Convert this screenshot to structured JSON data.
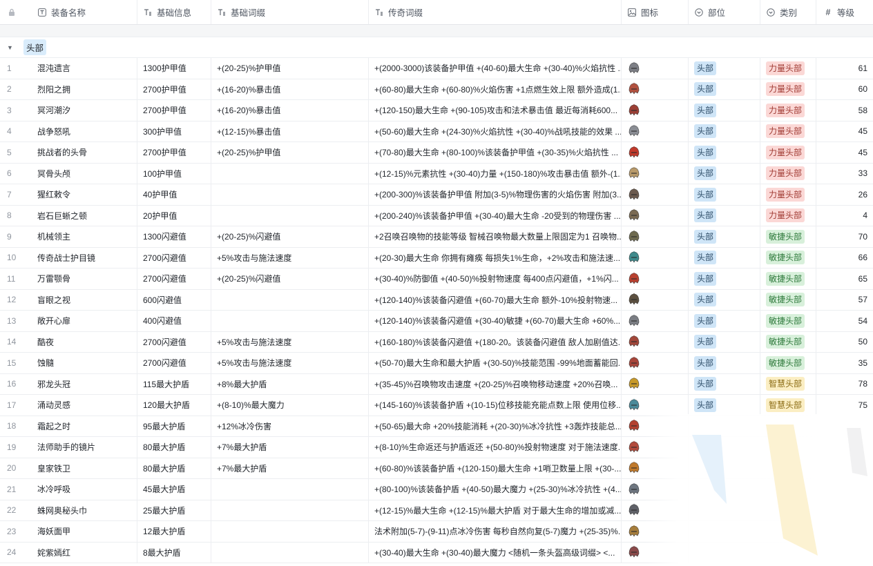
{
  "columns": [
    {
      "key": "lock",
      "label": "",
      "icon": "lock-icon"
    },
    {
      "key": "name",
      "label": "装备名称",
      "icon": "text-field-icon"
    },
    {
      "key": "base",
      "label": "基础信息",
      "icon": "long-text-icon"
    },
    {
      "key": "affix",
      "label": "基础词缀",
      "icon": "long-text-icon"
    },
    {
      "key": "legend",
      "label": "传奇词缀",
      "icon": "long-text-icon"
    },
    {
      "key": "img",
      "label": "图标",
      "icon": "image-icon"
    },
    {
      "key": "slot",
      "label": "部位",
      "icon": "single-select-icon"
    },
    {
      "key": "cat",
      "label": "类别",
      "icon": "single-select-icon"
    },
    {
      "key": "level",
      "label": "等级",
      "icon": "number-icon"
    }
  ],
  "group": {
    "label": "头部"
  },
  "colors": {
    "head": "#cfe5f7",
    "strength": "#fbd8d6",
    "agility": "#d8f0db",
    "intellect": "#fbeec3"
  },
  "rows": [
    {
      "n": "1",
      "name": "混沌遗言",
      "base": "1300护甲值",
      "affix": "+(20-25)%护甲值",
      "legend": "+(2000-3000)该装备护甲值 +(40-60)最大生命 +(30-40)%火焰抗性 ...",
      "slot": "头部",
      "cat": "力量头部",
      "catType": "str",
      "lvl": "61",
      "helm": "#7d7f86"
    },
    {
      "n": "2",
      "name": "烈阳之拥",
      "base": "2700护甲值",
      "affix": "+(16-20)%暴击值",
      "legend": "+(60-80)最大生命 +(60-80)%火焰伤害 +1点燃生效上限 额外造成(1...",
      "slot": "头部",
      "cat": "力量头部",
      "catType": "str",
      "lvl": "60",
      "helm": "#b2513f"
    },
    {
      "n": "3",
      "name": "冥河潮汐",
      "base": "2700护甲值",
      "affix": "+(16-20)%暴击值",
      "legend": "+(120-150)最大生命 +(90-105)攻击和法术暴击值 最近每消耗600...",
      "slot": "头部",
      "cat": "力量头部",
      "catType": "str",
      "lvl": "58",
      "helm": "#9c3f35"
    },
    {
      "n": "4",
      "name": "战争怒吼",
      "base": "300护甲值",
      "affix": "+(12-15)%暴击值",
      "legend": "+(50-60)最大生命 +(24-30)%火焰抗性 +(30-40)%战吼技能的效果 ...",
      "slot": "头部",
      "cat": "力量头部",
      "catType": "str",
      "lvl": "45",
      "helm": "#8a8d94"
    },
    {
      "n": "5",
      "name": "挑战者的头骨",
      "base": "2700护甲值",
      "affix": "+(20-25)%护甲值",
      "legend": "+(70-80)最大生命 +(80-100)%该装备护甲值 +(30-35)%火焰抗性 ...",
      "slot": "头部",
      "cat": "力量头部",
      "catType": "str",
      "lvl": "45",
      "helm": "#c0392b"
    },
    {
      "n": "6",
      "name": "冥骨头颅",
      "base": "100护甲值",
      "affix": "",
      "legend": "+(12-15)%元素抗性 +(30-40)力量 +(150-180)%攻击暴击值 额外-(1...",
      "slot": "头部",
      "cat": "力量头部",
      "catType": "str",
      "lvl": "33",
      "helm": "#b89a6a"
    },
    {
      "n": "7",
      "name": "猩红敕令",
      "base": "40护甲值",
      "affix": "",
      "legend": "+(200-300)%该装备护甲值 附加(3-5)%物理伤害的火焰伤害 附加(3...",
      "slot": "头部",
      "cat": "力量头部",
      "catType": "str",
      "lvl": "26",
      "helm": "#6b5a4e"
    },
    {
      "n": "8",
      "name": "岩石巨蜥之顿",
      "base": "20护甲值",
      "affix": "",
      "legend": "+(200-240)%该装备护甲值 +(30-40)最大生命 -20受到的物理伤害 ...",
      "slot": "头部",
      "cat": "力量头部",
      "catType": "str",
      "lvl": "4",
      "helm": "#7a6a52"
    },
    {
      "n": "9",
      "name": "机械领主",
      "base": "1300闪避值",
      "affix": "+(20-25)%闪避值",
      "legend": "+2召唤召唤物的技能等级 智械召唤物最大数量上限固定为1 召唤物...",
      "slot": "头部",
      "cat": "敏捷头部",
      "catType": "agi",
      "lvl": "70",
      "helm": "#6e6a4f"
    },
    {
      "n": "10",
      "name": "传奇战士护目镜",
      "base": "2700闪避值",
      "affix": "+5%攻击与施法速度",
      "legend": "+(20-30)最大生命 你拥有瘫痪 每损失1%生命，+2%攻击和施法速...",
      "slot": "头部",
      "cat": "敏捷头部",
      "catType": "agi",
      "lvl": "66",
      "helm": "#3f8a8c"
    },
    {
      "n": "11",
      "name": "万雷颚骨",
      "base": "2700闪避值",
      "affix": "+(20-25)%闪避值",
      "legend": "+(30-40)%防御值 +(40-50)%投射物速度 每400点闪避值，+1%闪...",
      "slot": "头部",
      "cat": "敏捷头部",
      "catType": "agi",
      "lvl": "65",
      "helm": "#b8402f"
    },
    {
      "n": "12",
      "name": "盲眼之视",
      "base": "600闪避值",
      "affix": "",
      "legend": "+(120-140)%该装备闪避值 +(60-70)最大生命 额外-10%投射物速...",
      "slot": "头部",
      "cat": "敏捷头部",
      "catType": "agi",
      "lvl": "57",
      "helm": "#5c5040"
    },
    {
      "n": "13",
      "name": "敞开心扉",
      "base": "400闪避值",
      "affix": "",
      "legend": "+(120-140)%该装备闪避值 +(30-40)敏捷 +(60-70)最大生命 +60%...",
      "slot": "头部",
      "cat": "敏捷头部",
      "catType": "agi",
      "lvl": "54",
      "helm": "#7b7e84"
    },
    {
      "n": "14",
      "name": "酷夜",
      "base": "2700闪避值",
      "affix": "+5%攻击与施法速度",
      "legend": "+(160-180)%该装备闪避值 +(180-20。该装备闪避值 敌人加剧值达...",
      "slot": "头部",
      "cat": "敏捷头部",
      "catType": "agi",
      "lvl": "50",
      "helm": "#a2473a"
    },
    {
      "n": "15",
      "name": "蚀髓",
      "base": "2700闪避值",
      "affix": "+5%攻击与施法速度",
      "legend": "+(50-70)最大生命和最大护盾 +(30-50)%技能范围 -99%地面蓄能回...",
      "slot": "头部",
      "cat": "敏捷头部",
      "catType": "agi",
      "lvl": "35",
      "helm": "#a8453a"
    },
    {
      "n": "16",
      "name": "邪龙头冠",
      "base": "115最大护盾",
      "affix": "+8%最大护盾",
      "legend": "+(35-45)%召唤物攻击速度 +(20-25)%召唤物移动速度 +20%召唤...",
      "slot": "头部",
      "cat": "智慧头部",
      "catType": "int",
      "lvl": "78",
      "helm": "#c89a2a"
    },
    {
      "n": "17",
      "name": "涌动灵感",
      "base": "120最大护盾",
      "affix": "+(8-10)%最大魔力",
      "legend": "+(145-160)%该装备护盾 +(10-15)位移技能充能点数上限 使用位移...",
      "slot": "头部",
      "cat": "智慧头部",
      "catType": "int",
      "lvl": "75",
      "helm": "#4a8a9a"
    },
    {
      "n": "18",
      "name": "霜起之时",
      "base": "95最大护盾",
      "affix": "+12%冰冷伤害",
      "legend": "+(50-65)最大命 +20%技能消耗 +(20-30)%冰冷抗性 +3轰炸技能总...",
      "slot": "",
      "cat": "",
      "catType": "",
      "lvl": "",
      "helm": "#b3402f"
    },
    {
      "n": "19",
      "name": "法师助手的镜片",
      "base": "80最大护盾",
      "affix": "+7%最大护盾",
      "legend": "+(8-10)%生命返还与护盾返还 +(50-80)%投射物速度 对于施法速度...",
      "slot": "",
      "cat": "",
      "catType": "",
      "lvl": "",
      "helm": "#b24a3c"
    },
    {
      "n": "20",
      "name": "皇家铁卫",
      "base": "80最大护盾",
      "affix": "+7%最大护盾",
      "legend": "+(60-80)%该装备护盾 +(120-150)最大生命 +1哨卫数量上限 +(30-...",
      "slot": "",
      "cat": "",
      "catType": "",
      "lvl": "",
      "helm": "#c0792b"
    },
    {
      "n": "21",
      "name": "冰冷呼吸",
      "base": "45最大护盾",
      "affix": "",
      "legend": "+(80-100)%该装备护盾 +(40-50)最大魔力 +(25-30)%冰冷抗性 +(4...",
      "slot": "",
      "cat": "",
      "catType": "",
      "lvl": "",
      "helm": "#6e7680"
    },
    {
      "n": "22",
      "name": "蛛网奥秘头巾",
      "base": "25最大护盾",
      "affix": "",
      "legend": "+(12-15)%最大生命 +(12-15)%最大护盾 对于最大生命的增加或减...",
      "slot": "",
      "cat": "",
      "catType": "",
      "lvl": "",
      "helm": "#5f6168"
    },
    {
      "n": "23",
      "name": "海妖面甲",
      "base": "12最大护盾",
      "affix": "",
      "legend": "法术附加(5-7)-(9-11)点冰冷伤害 每秒自然向复(5-7)魔力 +(25-35)%...",
      "slot": "",
      "cat": "",
      "catType": "",
      "lvl": "",
      "helm": "#a67d3c"
    },
    {
      "n": "24",
      "name": "姹紫嫣红",
      "base": "8最大护盾",
      "affix": "",
      "legend": "+(30-40)最大生命 +(30-40)最大魔力 <随机一条头盔高级词缀> <...",
      "slot": "",
      "cat": "",
      "catType": "",
      "lvl": "",
      "helm": "#8a4a4a"
    }
  ]
}
